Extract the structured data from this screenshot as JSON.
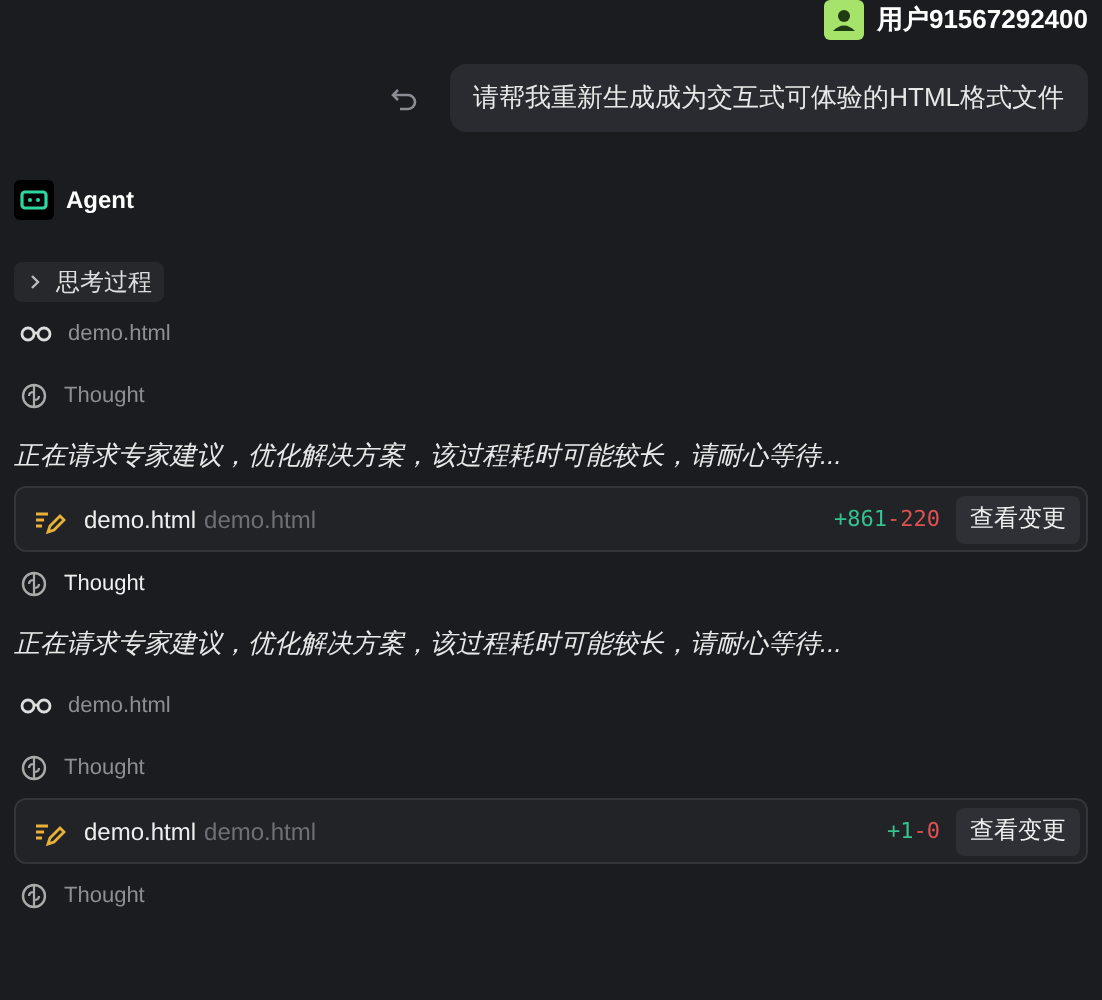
{
  "user": {
    "name": "用户91567292400"
  },
  "user_message": {
    "text": "请帮我重新生成成为交互式可体验的HTML格式文件"
  },
  "agent": {
    "name": "Agent"
  },
  "thinking_toggle": {
    "label": "思考过程",
    "expanded": false
  },
  "steps": [
    {
      "kind": "read",
      "file": "demo.html"
    },
    {
      "kind": "thought",
      "label": "Thought",
      "active": false
    },
    {
      "kind": "message",
      "text": "正在请求专家建议，优化解决方案，该过程耗时可能较长，请耐心等待..."
    },
    {
      "kind": "edit",
      "file": "demo.html",
      "path": "demo.html",
      "added": "+861",
      "removed": "-220",
      "button": "查看变更"
    },
    {
      "kind": "thought",
      "label": "Thought",
      "active": true
    },
    {
      "kind": "message",
      "text": "正在请求专家建议，优化解决方案，该过程耗时可能较长，请耐心等待..."
    },
    {
      "kind": "read",
      "file": "demo.html"
    },
    {
      "kind": "thought",
      "label": "Thought",
      "active": false
    },
    {
      "kind": "edit",
      "file": "demo.html",
      "path": "demo.html",
      "added": "+1",
      "removed": "-0",
      "button": "查看变更"
    },
    {
      "kind": "thought",
      "label": "Thought",
      "active": false
    }
  ]
}
